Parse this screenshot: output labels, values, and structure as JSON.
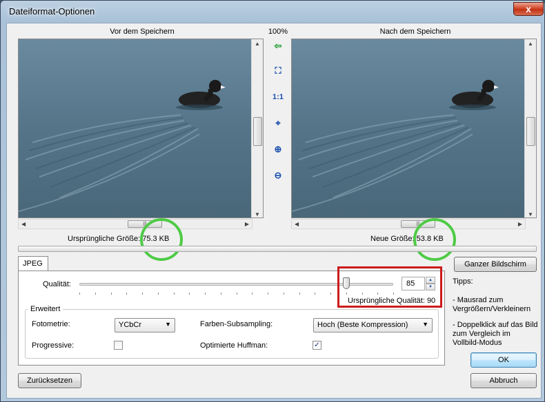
{
  "window": {
    "title": "Dateiformat-Optionen",
    "close_glyph": "x"
  },
  "preview": {
    "before_title": "Vor dem Speichern",
    "after_title": "Nach dem Speichern",
    "zoom": "100%",
    "before_size_label": "Ursprüngliche Größe:",
    "before_size_value": "75.3 KB",
    "after_size_label": "Neue Größe:",
    "after_size_value": "53.8 KB",
    "tools": [
      {
        "icon": "arrow-left-icon",
        "glyph": "⇦"
      },
      {
        "icon": "fit-to-window-icon",
        "glyph": "⛶"
      },
      {
        "icon": "actual-size-icon",
        "glyph": "1:1"
      },
      {
        "icon": "center-icon",
        "glyph": "⌖"
      },
      {
        "icon": "zoom-in-icon",
        "glyph": "⊕"
      },
      {
        "icon": "zoom-out-icon",
        "glyph": "⊖"
      }
    ],
    "scroll_thumb_glyph": "|||",
    "scroll_arrows": {
      "up": "▲",
      "down": "▼",
      "left": "◀",
      "right": "▶"
    }
  },
  "tab": {
    "label": "JPEG"
  },
  "quality": {
    "label": "Qualität:",
    "value": "85",
    "slider_percent": 85,
    "original_label": "Ursprüngliche Qualität: 90",
    "spin_up": "▲",
    "spin_down": "▼"
  },
  "advanced": {
    "title": "Erweitert",
    "photometry_label": "Fotometrie:",
    "photometry_value": "YCbCr",
    "subsampling_label": "Farben-Subsampling:",
    "subsampling_value": "Hoch (Beste Kompression)",
    "progressive_label": "Progressive:",
    "progressive_checked": false,
    "huffman_label": "Optimierte Huffman:",
    "huffman_checked": true,
    "check_glyph": "✓",
    "dropdown_glyph": "▼"
  },
  "side": {
    "fullscreen_button": "Ganzer Bildschirm",
    "tips_title": "Tipps:",
    "tip1": "- Mausrad zum Vergrößern/Verkleinern",
    "tip2": "- Doppelklick auf das Bild zum Vergleich im Vollbild-Modus",
    "ok_button": "OK",
    "cancel_button": "Abbruch"
  },
  "reset_button": "Zurücksetzen",
  "colors": {
    "annotation_green": "#4ecb45",
    "annotation_red": "#cc1b1b",
    "water": "#5d7b90"
  }
}
